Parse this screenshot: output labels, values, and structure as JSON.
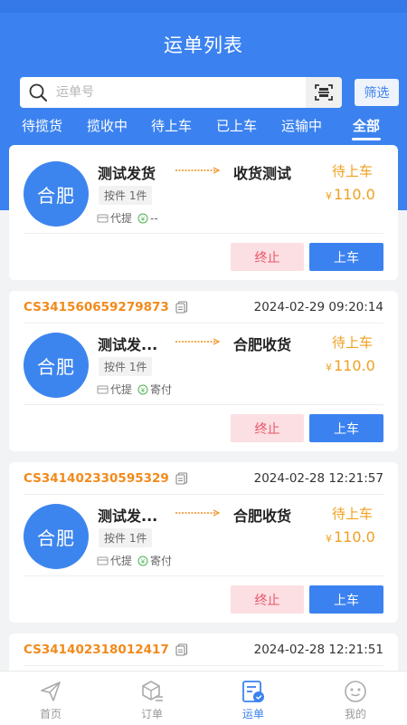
{
  "header": {
    "title": "运单列表"
  },
  "search": {
    "placeholder": "运单号",
    "filter_label": "筛选"
  },
  "tabs": [
    {
      "label": "待揽货",
      "active": false
    },
    {
      "label": "揽收中",
      "active": false
    },
    {
      "label": "待上车",
      "active": false
    },
    {
      "label": "已上车",
      "active": false
    },
    {
      "label": "运输中",
      "active": false
    },
    {
      "label": "全部",
      "active": true
    }
  ],
  "orders": [
    {
      "order_no": "",
      "time": "",
      "avatar": "合肥",
      "sender": "测试发货",
      "receiver": "收货测试",
      "status": "待上车",
      "pieces": "按件 1件",
      "currency": "¥",
      "price": "110.0",
      "meta_a": "代提",
      "meta_b": "--",
      "stop_label": "终止",
      "load_label": "上车"
    },
    {
      "order_no": "CS341560659279873",
      "time": "2024-02-29 09:20:14",
      "avatar": "合肥",
      "sender": "测试发...",
      "receiver": "合肥收货",
      "status": "待上车",
      "pieces": "按件 1件",
      "currency": "¥",
      "price": "110.0",
      "meta_a": "代提",
      "meta_b": "寄付",
      "stop_label": "终止",
      "load_label": "上车"
    },
    {
      "order_no": "CS341402330595329",
      "time": "2024-02-28 12:21:57",
      "avatar": "合肥",
      "sender": "测试发...",
      "receiver": "合肥收货",
      "status": "待上车",
      "pieces": "按件 1件",
      "currency": "¥",
      "price": "110.0",
      "meta_a": "代提",
      "meta_b": "寄付",
      "stop_label": "终止",
      "load_label": "上车"
    },
    {
      "order_no": "CS341402318012417",
      "time": "2024-02-28 12:21:51"
    }
  ],
  "nav": [
    {
      "label": "首页",
      "icon": "paper-plane-icon",
      "active": false
    },
    {
      "label": "订单",
      "icon": "box-list-icon",
      "active": false
    },
    {
      "label": "运单",
      "icon": "waybill-icon",
      "active": true
    },
    {
      "label": "我的",
      "icon": "smiley-icon",
      "active": false
    }
  ],
  "colors": {
    "primary": "#3b82f0",
    "order_no": "#f28a1c",
    "status": "#f0a020",
    "stop_bg": "#fbdfe2",
    "stop_text": "#e8556a"
  }
}
